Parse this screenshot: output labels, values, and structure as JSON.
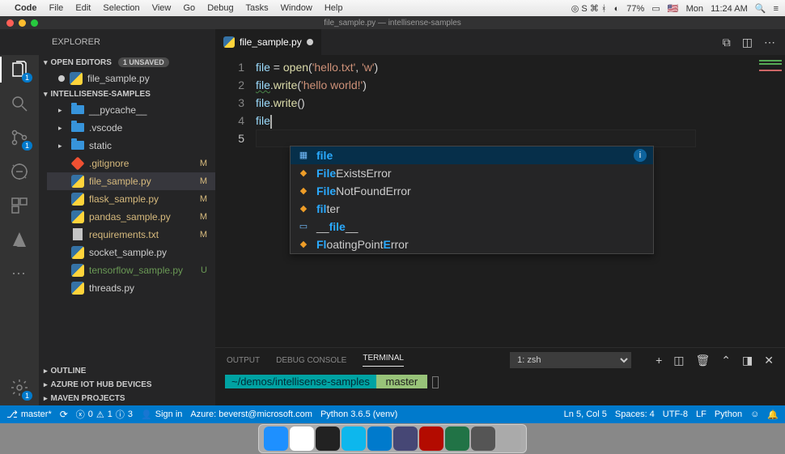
{
  "mac_menu": {
    "app": "Code",
    "items": [
      "File",
      "Edit",
      "Selection",
      "View",
      "Go",
      "Debug",
      "Tasks",
      "Window",
      "Help"
    ],
    "right": {
      "battery": "77%",
      "day": "Mon",
      "time": "11:24 AM"
    }
  },
  "window_title": "file_sample.py — intellisense-samples",
  "explorer": {
    "title": "EXPLORER"
  },
  "open_editors": {
    "title": "OPEN EDITORS",
    "unsaved": "1 UNSAVED",
    "items": [
      {
        "name": "file_sample.py",
        "dirty": true
      }
    ]
  },
  "workspace": {
    "title": "INTELLISENSE-SAMPLES",
    "tree": [
      {
        "type": "folder",
        "name": "__pycache__"
      },
      {
        "type": "folder",
        "name": ".vscode"
      },
      {
        "type": "folder",
        "name": "static"
      },
      {
        "type": "file",
        "name": ".gitignore",
        "icon": "git",
        "mod": "M"
      },
      {
        "type": "file",
        "name": "file_sample.py",
        "icon": "py",
        "mod": "M",
        "selected": true
      },
      {
        "type": "file",
        "name": "flask_sample.py",
        "icon": "py",
        "mod": "M"
      },
      {
        "type": "file",
        "name": "pandas_sample.py",
        "icon": "py",
        "mod": "M"
      },
      {
        "type": "file",
        "name": "requirements.txt",
        "icon": "txt",
        "mod": "M"
      },
      {
        "type": "file",
        "name": "socket_sample.py",
        "icon": "py"
      },
      {
        "type": "file",
        "name": "tensorflow_sample.py",
        "icon": "py",
        "unt": "U"
      },
      {
        "type": "file",
        "name": "threads.py",
        "icon": "py"
      }
    ]
  },
  "outline": {
    "title": "OUTLINE"
  },
  "azure": {
    "title": "AZURE IOT HUB DEVICES"
  },
  "maven": {
    "title": "MAVEN PROJECTS"
  },
  "tab": {
    "name": "file_sample.py"
  },
  "code": {
    "lines": [
      {
        "n": "1",
        "html": "<span class='tk-var'>file</span> <span class='tk-op'>=</span> <span class='tk-fn'>open</span><span class='tk-punc'>(</span><span class='tk-str'>'hello.txt'</span><span class='tk-punc'>,</span> <span class='tk-str'>'w'</span><span class='tk-punc'>)</span>"
      },
      {
        "n": "2",
        "html": "<span class='tk-var squiggle'>file</span><span class='tk-punc'>.</span><span class='tk-fn'>write</span><span class='tk-punc'>(</span><span class='tk-str'>'hello world!'</span><span class='tk-punc'>)</span>"
      },
      {
        "n": "3",
        "html": ""
      },
      {
        "n": "4",
        "html": "<span class='tk-var'>file</span><span class='tk-punc'>.</span><span class='tk-fn'>write</span><span class='tk-punc'>()</span>"
      },
      {
        "n": "5",
        "html": "<span class='tk-var'>file</span><span class='cursor'></span>",
        "active": true
      }
    ]
  },
  "intellisense": {
    "items": [
      {
        "kind": "variable",
        "pre": "file",
        "post": "",
        "sel": true,
        "info": true
      },
      {
        "kind": "class",
        "pre": "File",
        "post": "ExistsError"
      },
      {
        "kind": "class",
        "pre": "File",
        "post": "NotFoundError"
      },
      {
        "kind": "class",
        "pre": "fil",
        "post": "ter"
      },
      {
        "kind": "field",
        "pre": "",
        "mid": "__",
        "post": "file",
        "suf": "__"
      },
      {
        "kind": "class",
        "pre": "Fl",
        "post": "oatingPoint",
        "suf2": "E",
        "suf3": "rror"
      }
    ]
  },
  "panel": {
    "tabs": [
      "OUTPUT",
      "DEBUG CONSOLE",
      "TERMINAL"
    ],
    "active": "TERMINAL",
    "shell": "1: zsh",
    "prompt_path": "~/demos/intellisense-samples",
    "prompt_branch": " master"
  },
  "status": {
    "branch": "master*",
    "sync": "",
    "errors": "0",
    "warnings": "1",
    "infos": "3",
    "signin": "Sign in",
    "azure": "Azure: beverst@microsoft.com",
    "python": "Python 3.6.5 (venv)",
    "pos": "Ln 5, Col 5",
    "spaces": "Spaces: 4",
    "encoding": "UTF-8",
    "eol": "LF",
    "lang": "Python",
    "feedback": "☺"
  },
  "activity_badges": {
    "explorer": "1",
    "scm": "1",
    "settings": "1"
  },
  "dock": [
    {
      "name": "finder",
      "c": "#1e90ff"
    },
    {
      "name": "chrome",
      "c": "#fff"
    },
    {
      "name": "terminal",
      "c": "#222"
    },
    {
      "name": "docker",
      "c": "#0db7ed"
    },
    {
      "name": "vscode",
      "c": "#007acc"
    },
    {
      "name": "teams",
      "c": "#464775"
    },
    {
      "name": "adobe",
      "c": "#b30b00"
    },
    {
      "name": "excel",
      "c": "#217346"
    },
    {
      "name": "app",
      "c": "#555"
    },
    {
      "name": "trash",
      "c": "#aaa"
    }
  ]
}
